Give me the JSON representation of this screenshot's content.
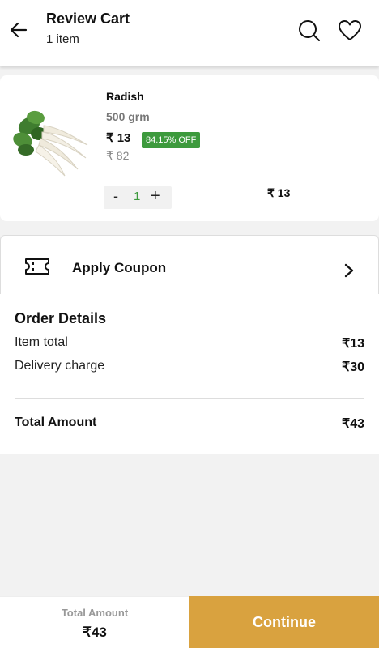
{
  "header": {
    "title": "Review Cart",
    "subtitle": "1 item"
  },
  "icons": {
    "back": "arrow-left-icon",
    "search": "search-icon",
    "wishlist": "heart-icon",
    "coupon": "ticket-icon",
    "chevron": "chevron-right-icon"
  },
  "cart": {
    "items": [
      {
        "name": "Radish",
        "weight": "500 grm",
        "price": "₹ 13",
        "discount": "84.15% OFF",
        "mrp": "₹ 82",
        "quantity": "1",
        "minus": "-",
        "plus": "+",
        "line_total": "₹ 13"
      }
    ]
  },
  "coupon": {
    "label": "Apply Coupon"
  },
  "order": {
    "title": "Order Details",
    "rows": [
      {
        "label": "Item total",
        "value": "₹13"
      },
      {
        "label": "Delivery charge",
        "value": "₹30"
      }
    ],
    "total_label": "Total Amount",
    "total_value": "₹43"
  },
  "footer": {
    "total_label": "Total Amount",
    "total_value": "₹43",
    "continue_label": "Continue"
  },
  "colors": {
    "accent": "#d9a23f",
    "discount_badge": "#3d9a3d"
  }
}
